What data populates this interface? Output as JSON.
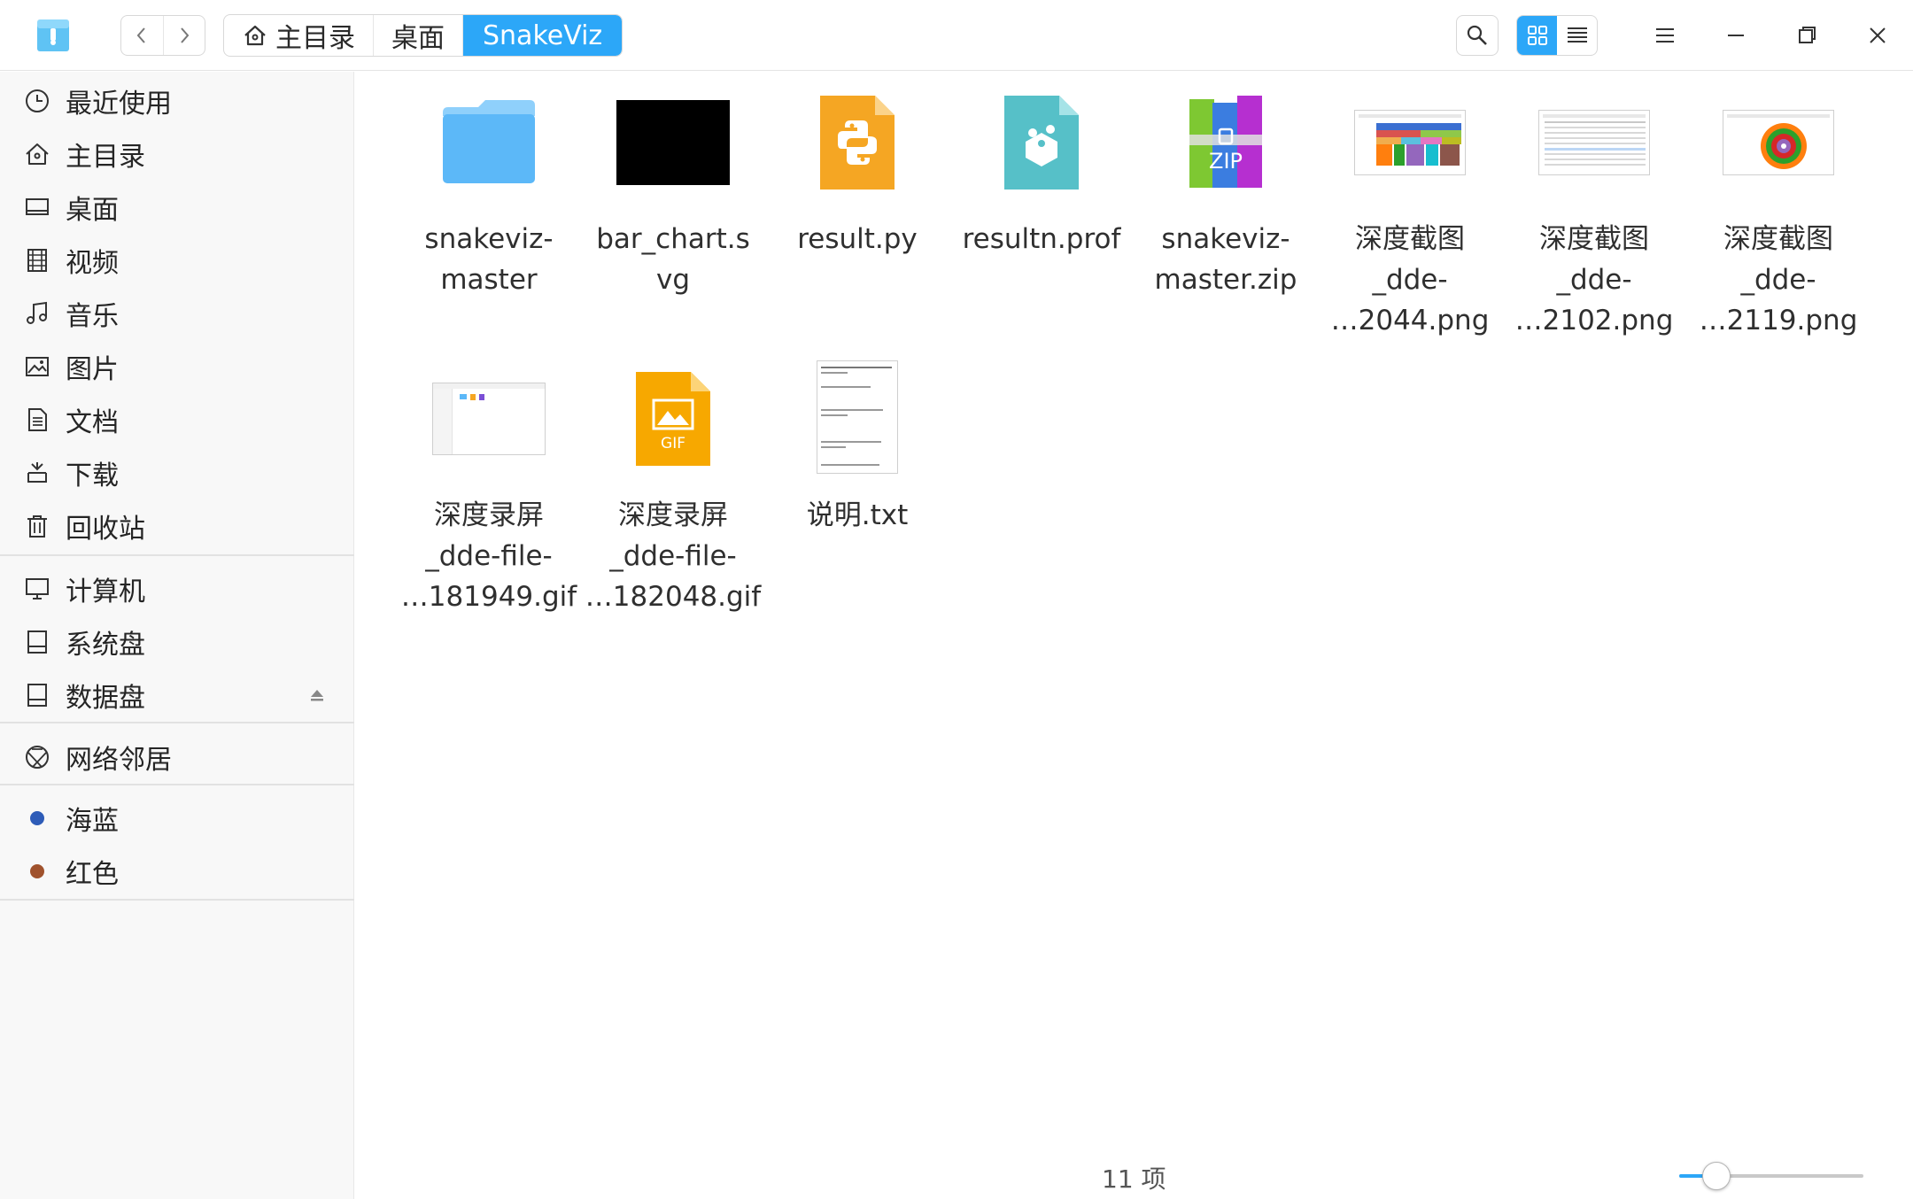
{
  "titlebar": {
    "breadcrumbs": [
      {
        "label": "主目录",
        "icon": "home-icon"
      },
      {
        "label": "桌面"
      },
      {
        "label": "SnakeViz",
        "active": true
      }
    ]
  },
  "sidebar": {
    "places": [
      {
        "label": "最近使用",
        "icon": "clock-icon"
      },
      {
        "label": "主目录",
        "icon": "home-icon"
      },
      {
        "label": "桌面",
        "icon": "desktop-icon"
      },
      {
        "label": "视频",
        "icon": "video-icon"
      },
      {
        "label": "音乐",
        "icon": "music-icon"
      },
      {
        "label": "图片",
        "icon": "picture-icon"
      },
      {
        "label": "文档",
        "icon": "document-icon"
      },
      {
        "label": "下载",
        "icon": "download-icon"
      },
      {
        "label": "回收站",
        "icon": "trash-icon"
      }
    ],
    "devices": [
      {
        "label": "计算机",
        "icon": "computer-icon"
      },
      {
        "label": "系统盘",
        "icon": "disk-icon"
      },
      {
        "label": "数据盘",
        "icon": "disk-icon",
        "ejectable": true
      }
    ],
    "network": {
      "label": "网络邻居",
      "icon": "network-icon"
    },
    "tags": [
      {
        "label": "海蓝",
        "color": "#2e5cb8"
      },
      {
        "label": "红色",
        "color": "#a0522d"
      }
    ]
  },
  "files": [
    {
      "name": "snakeviz-\nmaster",
      "type": "folder"
    },
    {
      "name": "bar_chart.s\nvg",
      "type": "svg"
    },
    {
      "name": "result.py",
      "type": "python"
    },
    {
      "name": "resultn.prof",
      "type": "prof"
    },
    {
      "name": "snakeviz-\nmaster.zip",
      "type": "zip"
    },
    {
      "name": "深度截图\n_dde-\n…2044.png",
      "type": "png"
    },
    {
      "name": "深度截图\n_dde-\n…2102.png",
      "type": "png"
    },
    {
      "name": "深度截图\n_dde-\n…2119.png",
      "type": "png"
    },
    {
      "name": "深度录屏\n_dde-file-\n…181949.gif",
      "type": "gif-thumb"
    },
    {
      "name": "深度录屏\n_dde-file-\n…182048.gif",
      "type": "gif"
    },
    {
      "name": "说明.txt",
      "type": "txt"
    }
  ],
  "icon_labels": {
    "zip": "ZIP",
    "gif": "GIF"
  },
  "status": {
    "count_text": "11 项"
  },
  "zoom": {
    "level": 0.2
  },
  "colors": {
    "accent": "#2ca7f8",
    "folder": "#5cb8f8",
    "python": "#f5a623",
    "prof": "#56c0c8",
    "gif": "#f7a800"
  }
}
